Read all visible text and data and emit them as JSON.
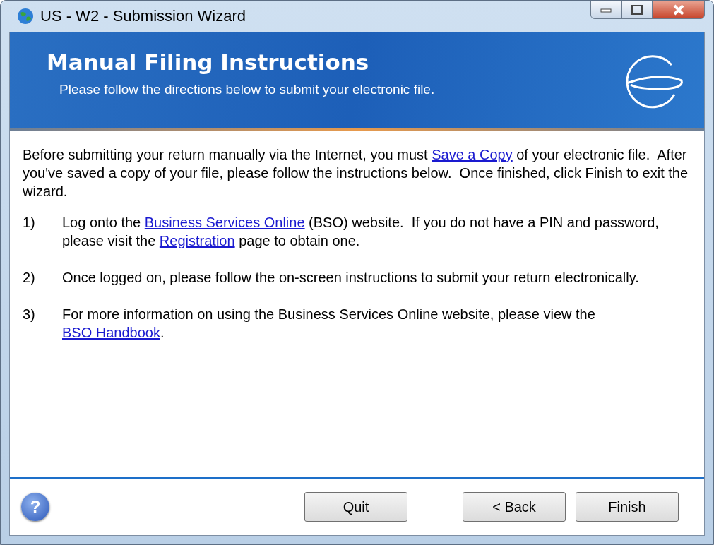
{
  "window": {
    "title": "US - W2 - Submission Wizard"
  },
  "header": {
    "title": "Manual Filing Instructions",
    "subtitle": "Please follow the directions below to submit your electronic file."
  },
  "intro": [
    {
      "kind": "text",
      "text": "Before submitting your return manually via the Internet, you must "
    },
    {
      "kind": "link",
      "text": "Save a Copy"
    },
    {
      "kind": "text",
      "text": " of your electronic file.  After you've saved a copy of your file, please follow the instructions below.  Once finished, click Finish to exit the wizard."
    }
  ],
  "steps": [
    {
      "number": "1)",
      "parts": [
        {
          "kind": "text",
          "text": "Log onto the "
        },
        {
          "kind": "link",
          "text": "Business Services Online"
        },
        {
          "kind": "text",
          "text": " (BSO) website.  If you do not have a PIN and password, please visit the "
        },
        {
          "kind": "link",
          "text": "Registration"
        },
        {
          "kind": "text",
          "text": " page to obtain one."
        }
      ]
    },
    {
      "number": "2)",
      "parts": [
        {
          "kind": "text",
          "text": "Once logged on, please follow the on-screen instructions to submit your return electronically."
        }
      ]
    },
    {
      "number": "3)",
      "parts": [
        {
          "kind": "text",
          "text": "For more information on using the Business Services Online website, please view the "
        },
        {
          "kind": "link",
          "text": "BSO Handbook"
        },
        {
          "kind": "text",
          "text": "."
        }
      ]
    }
  ],
  "footer": {
    "help": "?",
    "buttons": [
      {
        "label": "Quit",
        "kind": "quit"
      },
      {
        "label": "< Back",
        "kind": "back"
      },
      {
        "label": "Finish",
        "kind": "finish"
      }
    ]
  }
}
